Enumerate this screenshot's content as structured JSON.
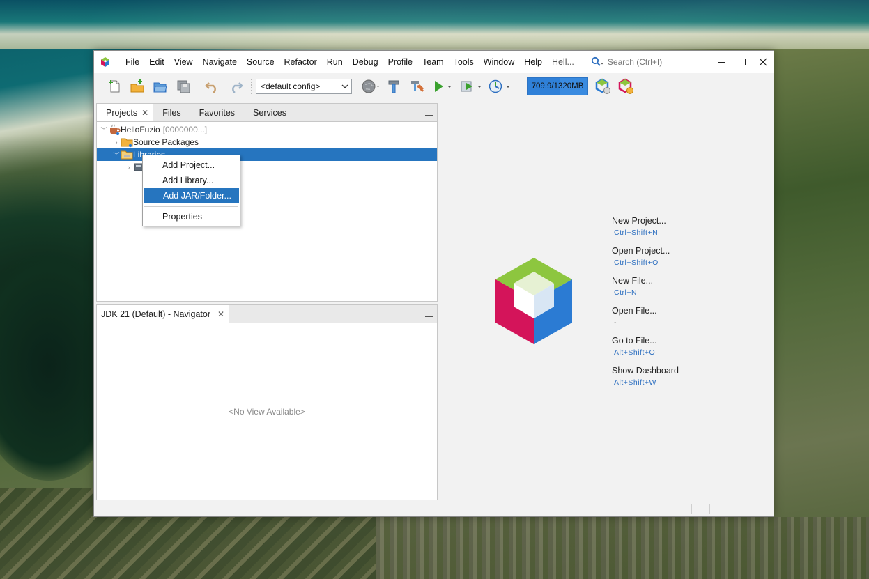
{
  "menu": {
    "items": [
      "File",
      "Edit",
      "View",
      "Navigate",
      "Source",
      "Refactor",
      "Run",
      "Debug",
      "Profile",
      "Team",
      "Tools",
      "Window",
      "Help",
      "Hell..."
    ]
  },
  "search": {
    "placeholder": "Search (Ctrl+I)"
  },
  "toolbar": {
    "config": "<default config>",
    "memory": "709.9/1320MB",
    "memory_fraction": 0.54
  },
  "projects_panel": {
    "tabs": [
      "Projects",
      "Files",
      "Favorites",
      "Services"
    ],
    "tree": {
      "project": "HelloFuzio",
      "project_suffix": "[0000000...]",
      "source_packages": "Source Packages",
      "libraries": "Libraries"
    }
  },
  "context_menu": {
    "items": [
      "Add Project...",
      "Add Library...",
      "Add JAR/Folder...",
      "Properties"
    ]
  },
  "navigator_panel": {
    "tab": "JDK 21 (Default) - Navigator",
    "empty_text": "<No View Available>"
  },
  "quick_links": [
    {
      "label": "New Project...",
      "shortcut": "Ctrl+Shift+N"
    },
    {
      "label": "Open Project...",
      "shortcut": "Ctrl+Shift+O"
    },
    {
      "label": "New File...",
      "shortcut": "Ctrl+N"
    },
    {
      "label": "Open File...",
      "shortcut": "-"
    },
    {
      "label": "Go to File...",
      "shortcut": "Alt+Shift+O"
    },
    {
      "label": "Show Dashboard",
      "shortcut": "Alt+Shift+W"
    }
  ],
  "colors": {
    "selection": "#2675bf",
    "shortcut": "#2d6fc0",
    "logo_green": "#8dc63f",
    "logo_red": "#d4145a",
    "logo_blue": "#2b7bd3"
  }
}
